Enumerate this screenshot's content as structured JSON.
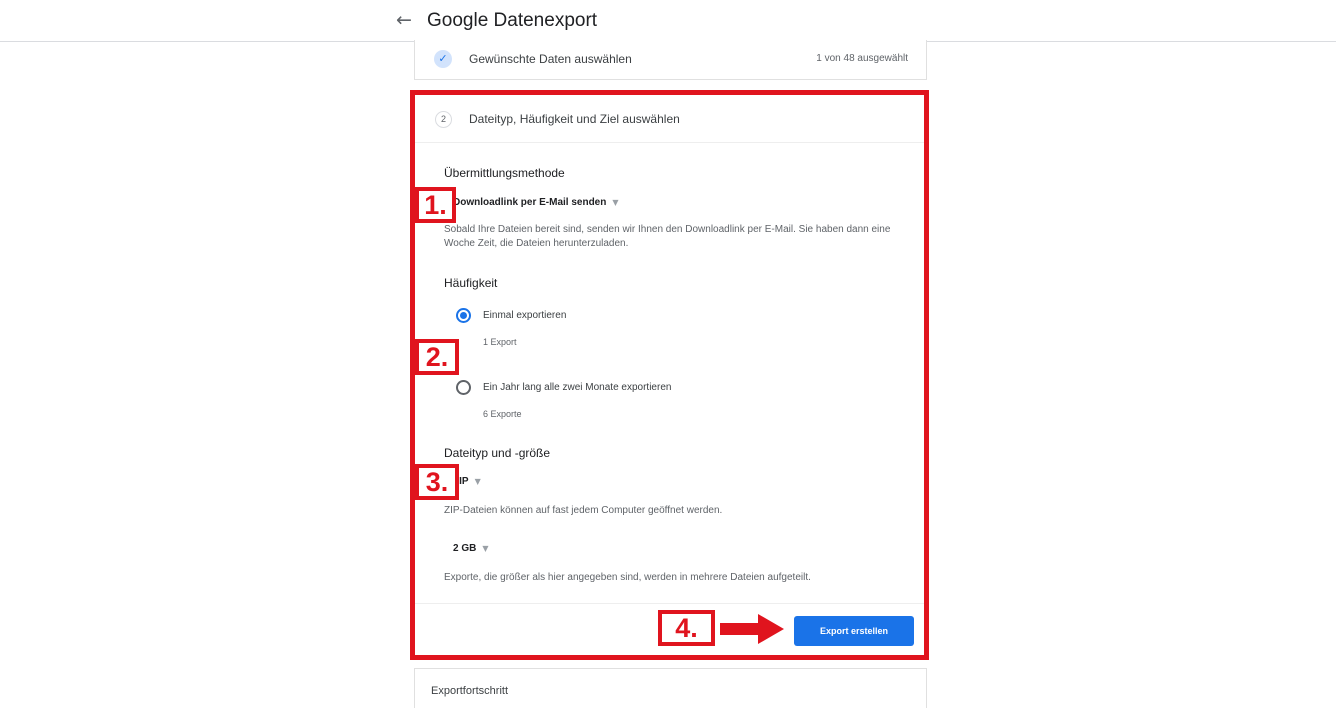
{
  "header": {
    "back_icon": "arrow-left-icon",
    "title": "Google Datenexport"
  },
  "step1": {
    "icon": "check-circle-icon",
    "label": "Gewünschte Daten auswählen",
    "count": "1 von 48 ausgewählt"
  },
  "step2": {
    "number": "2",
    "label": "Dateityp, Häufigkeit und Ziel auswählen",
    "delivery": {
      "title": "Übermittlungsmethode",
      "selected": "Downloadlink per E-Mail senden",
      "description": "Sobald Ihre Dateien bereit sind, senden wir Ihnen den Downloadlink per E-Mail. Sie haben dann eine Woche Zeit, die Dateien herunterzuladen."
    },
    "frequency": {
      "title": "Häufigkeit",
      "options": [
        {
          "label": "Einmal exportieren",
          "sub": "1 Export",
          "selected": true
        },
        {
          "label": "Ein Jahr lang alle zwei Monate exportieren",
          "sub": "6 Exporte",
          "selected": false
        }
      ]
    },
    "filetype": {
      "title": "Dateityp und -größe",
      "type_selected": "ZIP",
      "type_description": "ZIP-Dateien können auf fast jedem Computer geöffnet werden.",
      "size_selected": "2 GB",
      "size_description": "Exporte, die größer als hier angegeben sind, werden in mehrere Dateien aufgeteilt."
    },
    "export_button": "Export erstellen"
  },
  "progress": {
    "label": "Exportfortschritt"
  },
  "annotations": {
    "markers": [
      "1.",
      "2.",
      "3.",
      "4."
    ],
    "color": "#e0141e",
    "arrow_icon": "arrow-right-icon"
  },
  "colors": {
    "accent": "#1a73e8"
  }
}
